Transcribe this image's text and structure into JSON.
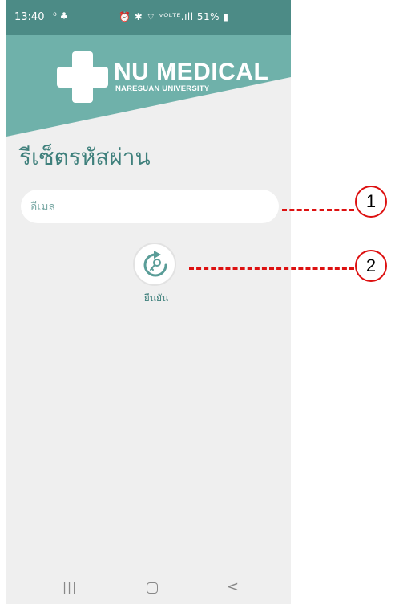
{
  "status_bar": {
    "time": "13:40",
    "left_icons": "⁰ ♣",
    "right_icons": "⏰ ✱ ⌔ ᵛᴼᴸᵀᴱ.ıll 51% ▮",
    "battery": "51%"
  },
  "header": {
    "brand_title": "NU MEDICAL",
    "brand_subtitle": "NARESUAN UNIVERSITY",
    "accent_color": "#6fb1aa"
  },
  "page": {
    "title": "รีเซ็ตรหัสผ่าน"
  },
  "form": {
    "email_placeholder": "อีเมล",
    "email_value": "",
    "confirm_label": "ยืนยัน"
  },
  "navigation": {
    "recent_icon": "|||",
    "home_icon": "home-icon",
    "back_icon": "<"
  },
  "callouts": [
    {
      "number": "1"
    },
    {
      "number": "2"
    }
  ]
}
